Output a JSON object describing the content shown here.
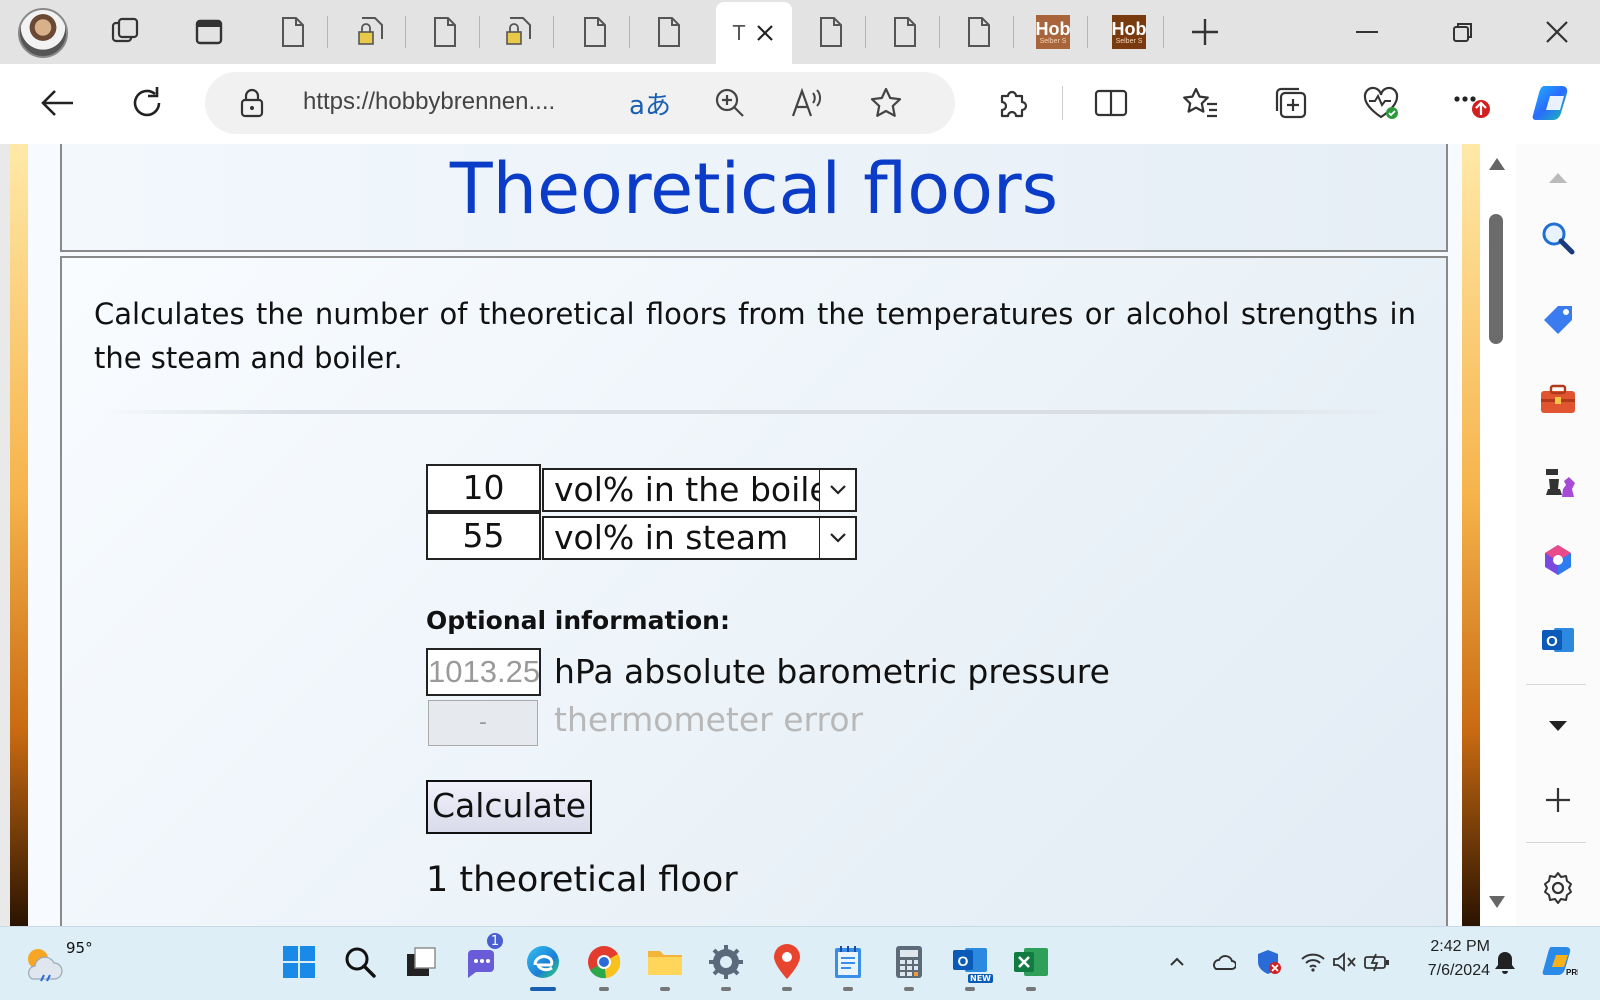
{
  "browser": {
    "active_tab_title": "T",
    "tab_favicon_text_1": "Hob",
    "tab_favicon_sub_1": "Selber S",
    "tab_favicon_text_2": "Hob",
    "tab_favicon_sub_2": "Selber S",
    "url": "https://hobbybrennen....",
    "translate_glyph": "aあ"
  },
  "page": {
    "title": "Theoretical floors",
    "description": "Calculates the number of theoretical floors from the temperatures or alcohol strengths in the steam and boiler.",
    "input_boiler_value": "10",
    "select_boiler_value": "vol% in the boile",
    "input_steam_value": "55",
    "select_steam_value": "vol% in steam",
    "optional_label": "Optional information:",
    "pressure_placeholder": "1013.25",
    "pressure_label": "hPa absolute barometric pressure",
    "thermometer_value": "-",
    "thermometer_label": "thermometer error",
    "calculate_label": "Calculate",
    "result": "1 theoretical floor"
  },
  "taskbar": {
    "temperature": "95°",
    "chat_badge": "1",
    "outlook_badge": "NEW",
    "time": "2:42 PM",
    "date": "7/6/2024"
  },
  "colors": {
    "title": "#0a3cc8",
    "accent": "#1a5fb4"
  }
}
